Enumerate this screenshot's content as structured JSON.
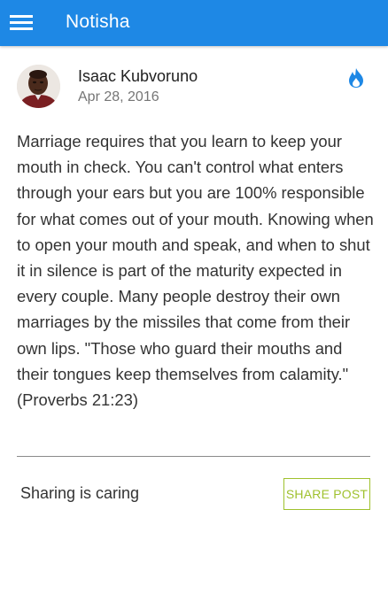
{
  "app_bar": {
    "title": "Notisha",
    "menu_icon": "hamburger-menu-icon",
    "background_color": "#1e88e5"
  },
  "post": {
    "author": "Isaac Kubvoruno",
    "date": "Apr 28, 2016",
    "avatar_icon": "avatar-photo",
    "hot_icon": "flame-icon",
    "hot_icon_color": "#1e88e5",
    "body": "Marriage requires that you learn to keep your mouth in check. You can't control what enters through your ears but you are 100% responsible for what comes out of your mouth. Knowing when to open your mouth and speak, and when to shut it in silence is part of the maturity expected in every couple. Many people destroy their own marriages by the missiles that come from their own lips. \"Those who guard their mouths and their tongues keep themselves from calamity.\" (Proverbs 21:23)"
  },
  "footer": {
    "sharing_text": "Sharing is caring",
    "share_button_label": "SHARE POST",
    "share_button_color": "#9fc12d"
  }
}
